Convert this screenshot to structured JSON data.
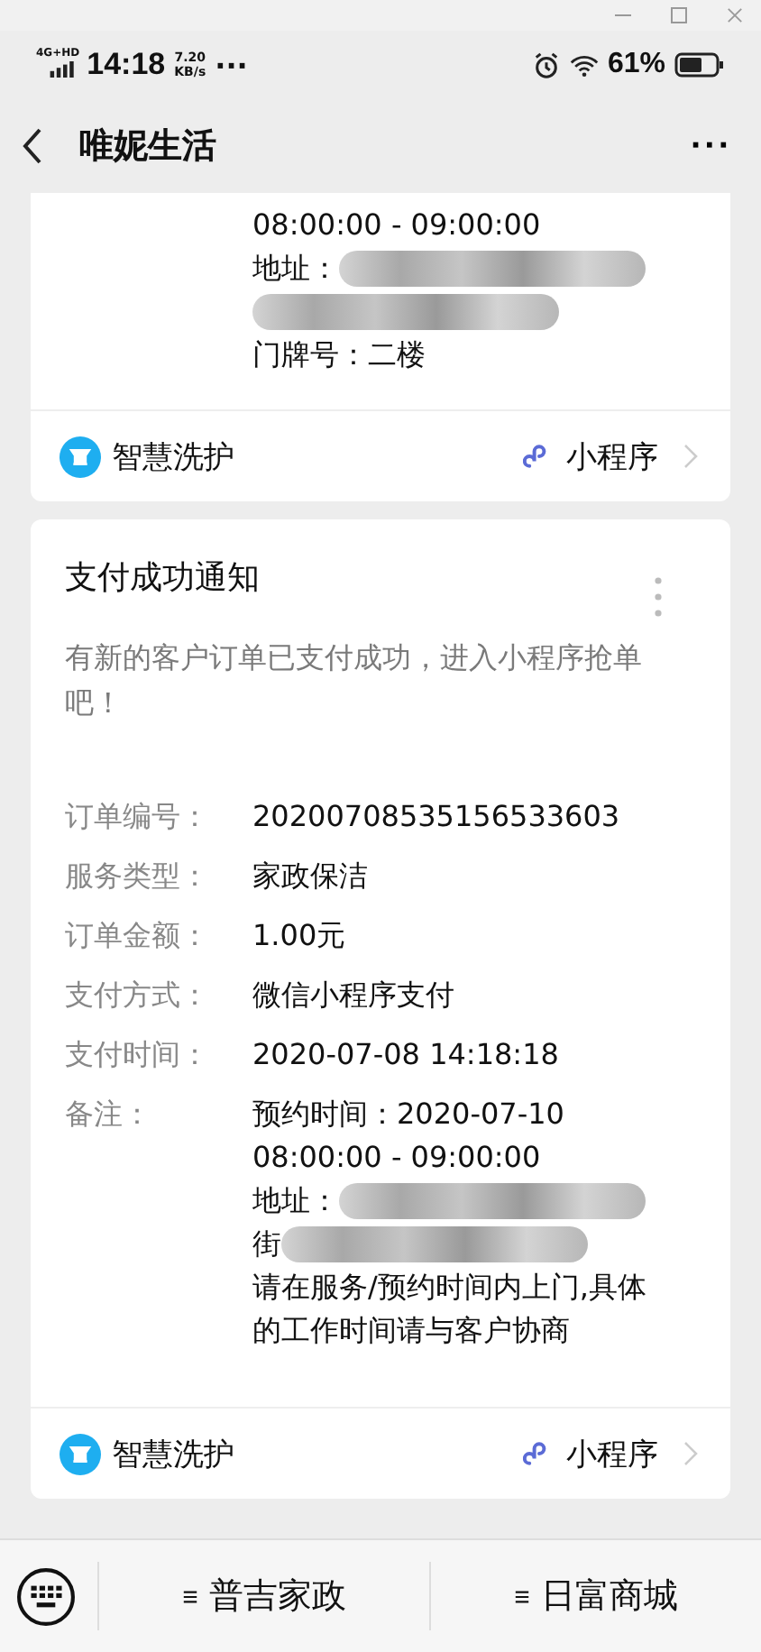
{
  "status_bar": {
    "network": "4G+HD",
    "time": "14:18",
    "speed": "7.20",
    "speed_unit": "KB/s",
    "more": "···",
    "battery": "61%"
  },
  "nav": {
    "title": "唯妮生活",
    "more": "···"
  },
  "cards": [
    {
      "partial": true,
      "remark_lines": [
        {
          "text": "08:00:00 - 09:00:00",
          "blurred": false
        },
        {
          "text": "地址：",
          "blurred": true
        },
        {
          "blurred": true
        },
        {
          "text": "门牌号：二楼",
          "blurred": false
        }
      ],
      "source": "智慧洗护",
      "badge": "小程序"
    },
    {
      "partial": false,
      "title": "支付成功通知",
      "message": "有新的客户订单已支付成功，进入小程序抢单吧！",
      "fields": [
        {
          "label": "订单编号：",
          "value": "20200708535156533603"
        },
        {
          "label": "服务类型：",
          "value": "家政保洁"
        },
        {
          "label": "订单金额：",
          "value": "1.00元"
        },
        {
          "label": "支付方式：",
          "value": "微信小程序支付"
        },
        {
          "label": "支付时间：",
          "value": "2020-07-08 14:18:18"
        }
      ],
      "remark_label": "备注：",
      "remark_lines": [
        {
          "text": "预约时间：2020-07-10",
          "blurred": false
        },
        {
          "text": "08:00:00 - 09:00:00",
          "blurred": false
        },
        {
          "text": "地址：",
          "blurred": true
        },
        {
          "text": "街",
          "blurred": true
        },
        {
          "text": "请在服务/预约时间内上门,具体",
          "blurred": false
        },
        {
          "text": "的工作时间请与客户协商",
          "blurred": false
        }
      ],
      "source": "智慧洗护",
      "badge": "小程序"
    }
  ],
  "bottom_menu": [
    "普吉家政",
    "日富商城"
  ]
}
